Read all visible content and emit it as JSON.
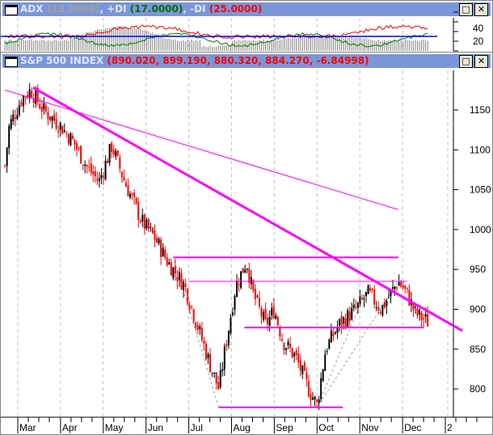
{
  "adx_panel": {
    "title": "ADX",
    "adx_value": "(13.0000)",
    "plus_di_label": "+DI",
    "plus_di_value": "(17.0000)",
    "minus_di_label": "-DI",
    "minus_di_value": "(25.0000)",
    "axis_labels": [
      "40",
      "20"
    ],
    "reference_level": 25,
    "colors": {
      "adx": "#808080",
      "plus_di": "#008000",
      "minus_di": "#ff0000",
      "reference": "#0000ff"
    }
  },
  "price_panel": {
    "title": "S&P 500 INDEX",
    "values": "(890.020, 899.190, 880.320, 884.270, -6.84998)"
  },
  "window_buttons": {
    "maximize": "□",
    "close": "✕"
  },
  "chart_data": {
    "type": "candlestick",
    "title": "S&P 500 INDEX",
    "x_unit": "months since Mar 1",
    "xlabels": [
      "Mar",
      "Apr",
      "May",
      "Jun",
      "Jul",
      "Aug",
      "Sep",
      "Oct",
      "Nov",
      "Dec",
      "2"
    ],
    "ylim": [
      755,
      1210
    ],
    "yticks": [
      1150,
      1100,
      1050,
      1000,
      950,
      900,
      850,
      800
    ],
    "close_waypoints": [
      [
        -0.3,
        1080
      ],
      [
        -0.2,
        1130
      ],
      [
        0.1,
        1165
      ],
      [
        0.3,
        1175
      ],
      [
        0.6,
        1150
      ],
      [
        1,
        1130
      ],
      [
        1.3,
        1110
      ],
      [
        1.6,
        1080
      ],
      [
        1.9,
        1060
      ],
      [
        2.2,
        1105
      ],
      [
        2.5,
        1060
      ],
      [
        2.9,
        1010
      ],
      [
        3.2,
        990
      ],
      [
        3.5,
        960
      ],
      [
        3.9,
        930
      ],
      [
        4.2,
        880
      ],
      [
        4.5,
        830
      ],
      [
        4.7,
        800
      ],
      [
        4.85,
        850
      ],
      [
        5.1,
        930
      ],
      [
        5.35,
        960
      ],
      [
        5.5,
        920
      ],
      [
        5.8,
        880
      ],
      [
        6.0,
        900
      ],
      [
        6.2,
        860
      ],
      [
        6.5,
        840
      ],
      [
        6.8,
        800
      ],
      [
        7.0,
        780
      ],
      [
        7.2,
        850
      ],
      [
        7.5,
        880
      ],
      [
        7.9,
        900
      ],
      [
        8.2,
        920
      ],
      [
        8.5,
        900
      ],
      [
        8.9,
        935
      ],
      [
        9.1,
        920
      ],
      [
        9.3,
        895
      ],
      [
        9.6,
        884
      ]
    ],
    "trendlines": [
      {
        "name": "major-downtrend",
        "from": [
          0.36,
          1178
        ],
        "to": [
          10.4,
          873
        ],
        "weight": "thick"
      },
      {
        "name": "long-downtrend",
        "from": [
          -0.3,
          1175
        ],
        "to": [
          8.9,
          1025
        ],
        "weight": "thin"
      },
      {
        "name": "resistance-965",
        "from": [
          3.64,
          965
        ],
        "to": [
          8.9,
          965
        ],
        "weight": "medium"
      },
      {
        "name": "resistance-935",
        "from": [
          4.0,
          935
        ],
        "to": [
          9.1,
          935
        ],
        "weight": "thin"
      },
      {
        "name": "support-877",
        "from": [
          5.3,
          877
        ],
        "to": [
          9.5,
          877
        ],
        "weight": "medium"
      },
      {
        "name": "support-777",
        "from": [
          4.7,
          777
        ],
        "to": [
          7.6,
          777
        ],
        "weight": "medium"
      }
    ]
  }
}
